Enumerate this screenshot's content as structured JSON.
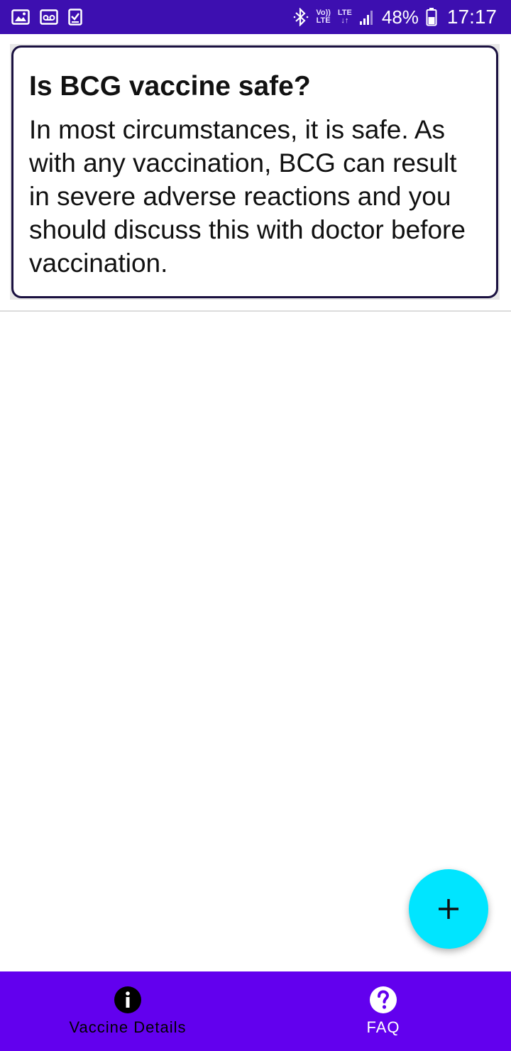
{
  "status_bar": {
    "net_top": "Vo))",
    "net_bottom": "LTE",
    "lte": "LTE",
    "battery_percent": "48%",
    "time": "17:17",
    "left_icons": [
      "gallery-icon",
      "voicemail-icon",
      "task-icon"
    ]
  },
  "card": {
    "title": "Is BCG vaccine safe?",
    "body": "In most circumstances, it is safe. As with any vaccination, BCG can result in severe adverse reactions and you should discuss this with doctor before vaccination."
  },
  "fab": {
    "icon": "plus-icon",
    "color": "#00e5ff"
  },
  "bottom_nav": {
    "items": [
      {
        "label": "Vaccine Details",
        "icon": "info-icon",
        "active": true
      },
      {
        "label": "FAQ",
        "icon": "help-icon",
        "active": false
      }
    ],
    "background": "#6200ee"
  },
  "colors": {
    "status_bar": "#3d0fb0",
    "card_border": "#1a1140"
  }
}
